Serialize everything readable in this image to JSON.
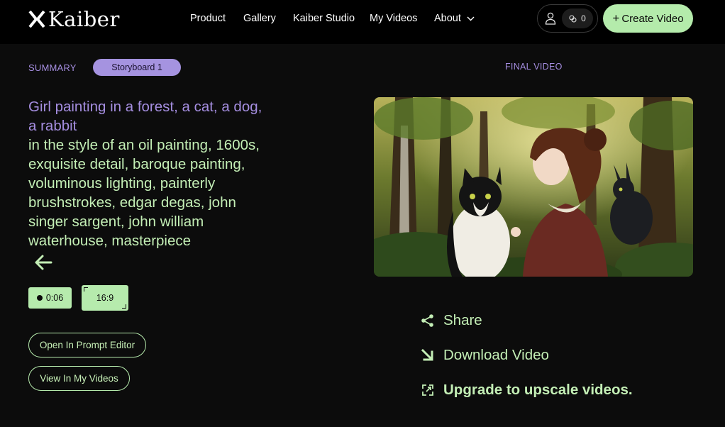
{
  "nav": {
    "logo_text": "Kaiber",
    "links": {
      "product": "Product",
      "gallery": "Gallery",
      "studio": "Kaiber Studio",
      "my_videos": "My Videos",
      "about": "About"
    },
    "credits": "0",
    "create_button": "Create Video"
  },
  "summary": {
    "label": "SUMMARY",
    "storyboard_tab": "Storyboard 1",
    "prompt_subject": "Girl painting in a forest, a cat, a dog, a rabbit",
    "prompt_style": "in the style of an oil painting, 1600s, exquisite detail, baroque painting, voluminous lighting, painterly brushstrokes, edgar degas, john singer sargent, john william waterhouse, masterpiece",
    "duration": "0:06",
    "aspect_ratio": "16:9",
    "open_prompt_editor": "Open In Prompt Editor",
    "view_in_my_videos": "View In My Videos"
  },
  "final_video": {
    "label": "FINAL VIDEO",
    "share": "Share",
    "download": "Download Video",
    "upgrade": "Upgrade to upscale videos."
  },
  "colors": {
    "accent_green": "#b6ebad",
    "accent_purple": "#a58ee0",
    "background": "#0c0c0c"
  },
  "icons": {
    "user": "user-icon",
    "credits": "credits-icon",
    "back": "arrow-left-icon",
    "share": "share-icon",
    "download": "download-arrow-icon",
    "upgrade": "upscale-icon"
  }
}
